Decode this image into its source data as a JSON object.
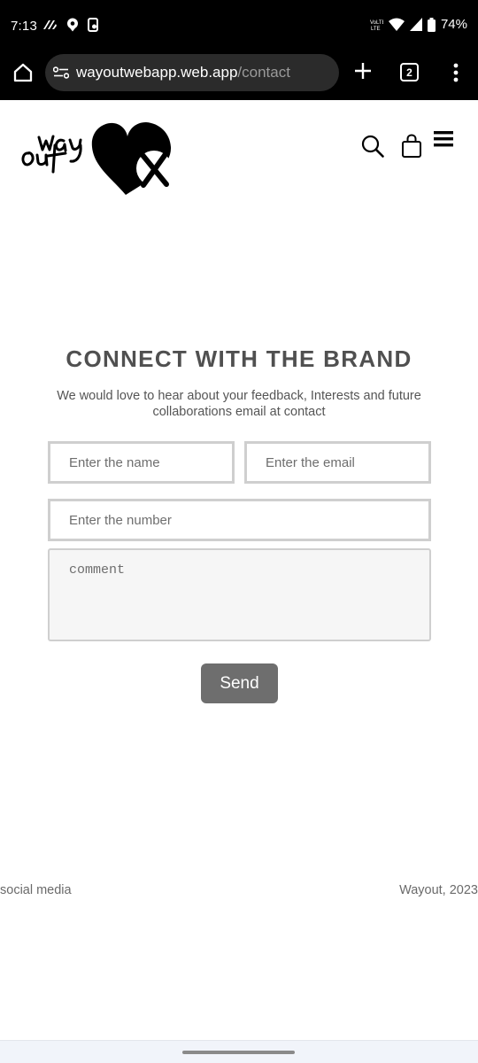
{
  "status_bar": {
    "time": "7:13",
    "battery": "74%"
  },
  "browser": {
    "url_domain": "wayoutwebapp.web.app",
    "url_path": "/contact",
    "tab_count": "2"
  },
  "site": {
    "logo_text": "way out",
    "logo_mark": "X"
  },
  "contact": {
    "title": "CONNECT WITH THE BRAND",
    "description": "We would love to hear about your feedback, Interests and future collaborations email at contact",
    "name_placeholder": "Enter the name",
    "email_placeholder": "Enter the email",
    "number_placeholder": "Enter the number",
    "comment_placeholder": "comment",
    "send_label": "Send"
  },
  "footer": {
    "left": "social media",
    "right": "Wayout, 2023"
  }
}
